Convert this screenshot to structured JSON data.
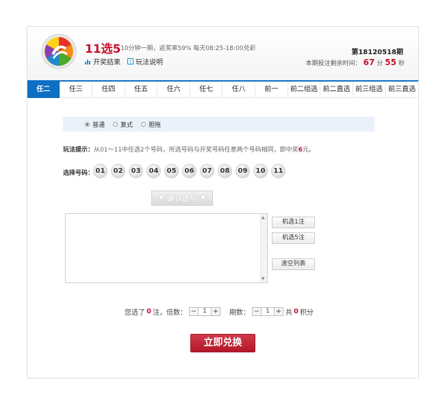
{
  "header": {
    "title": "11选5",
    "subtitle": "10分钟一期，返奖率59% 每天08:25-18:00兑彩",
    "links": [
      {
        "label": "开奖结果",
        "icon": "bar-chart-icon"
      },
      {
        "label": "玩法说明",
        "icon": "help-icon"
      }
    ],
    "period": "第18120518期",
    "countdown": {
      "label": "本期投注剩余时间：",
      "minutes": "67",
      "min_unit": "分",
      "seconds": "55",
      "sec_unit": "秒"
    }
  },
  "tabs": [
    "任二",
    "任三",
    "任四",
    "任五",
    "任六",
    "任七",
    "任八",
    "前一",
    "前二组选",
    "前二直选",
    "前三组选",
    "前三直选"
  ],
  "active_tab": 0,
  "modes": [
    {
      "label": "普通",
      "selected": true
    },
    {
      "label": "复式",
      "selected": false
    },
    {
      "label": "胆拖",
      "selected": false
    }
  ],
  "hint": {
    "label": "玩法提示：",
    "text": "从01～11中任选2个号码，所选号码与开奖号码任意两个号码相同，即中奖",
    "amount": "6",
    "unit": "元。"
  },
  "pick": {
    "label": "选择号码：",
    "numbers": [
      "01",
      "02",
      "03",
      "04",
      "05",
      "06",
      "07",
      "08",
      "09",
      "10",
      "11"
    ]
  },
  "confirm_label": "确认选号",
  "side_buttons": {
    "random1": "机选1注",
    "random5": "机选5注",
    "clear": "清空列表"
  },
  "summary": {
    "prefix": "您选了",
    "count": "0",
    "count_unit": "注，倍数：",
    "multiplier": "1",
    "periods_label": "期数：",
    "periods": "1",
    "total_prefix": "共",
    "total": "0",
    "total_unit": "积分"
  },
  "redeem_label": "立即兑换",
  "colors": {
    "accent_blue": "#0c6fc4",
    "brand_red": "#c8102e"
  }
}
